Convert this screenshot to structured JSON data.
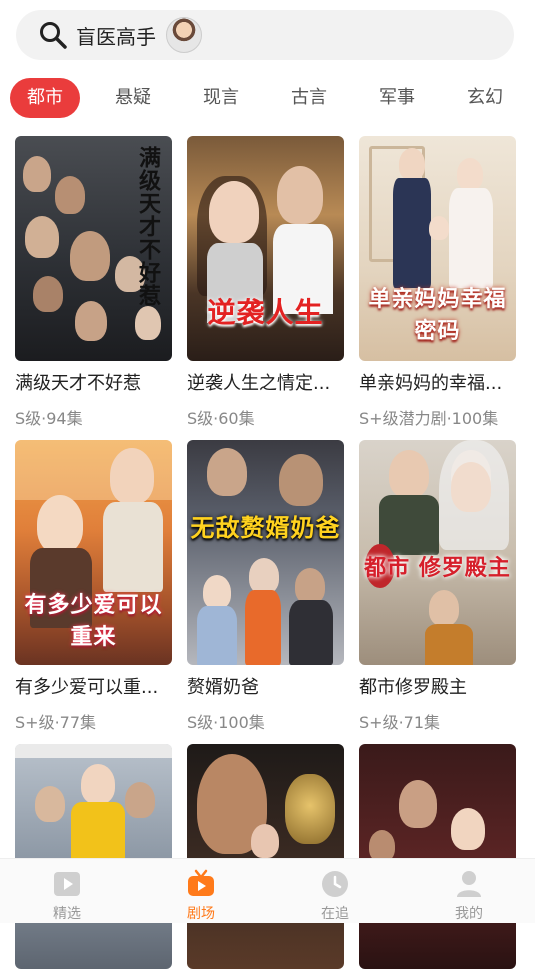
{
  "search": {
    "query": "盲医高手"
  },
  "tabs": [
    "都市",
    "悬疑",
    "现言",
    "古言",
    "军事",
    "玄幻"
  ],
  "cards": [
    {
      "title": "满级天才不好惹",
      "sub": "S级·94集",
      "poster_text": "满级天才不好惹"
    },
    {
      "title": "逆袭人生之情定...",
      "sub": "S级·60集",
      "poster_text": "逆袭人生"
    },
    {
      "title": "单亲妈妈的幸福...",
      "sub": "S+级潜力剧·100集",
      "poster_text": "单亲妈妈幸福密码"
    },
    {
      "title": "有多少爱可以重...",
      "sub": "S+级·77集",
      "poster_text": "有多少爱可以重来"
    },
    {
      "title": "赘婿奶爸",
      "sub": "S级·100集",
      "poster_text": "无敌赘婿奶爸"
    },
    {
      "title": "都市修罗殿主",
      "sub": "S+级·71集",
      "poster_text": "都市 修罗殿主"
    },
    {
      "title": "",
      "sub": "",
      "poster_text": ""
    },
    {
      "title": "",
      "sub": "",
      "poster_text": ""
    },
    {
      "title": "",
      "sub": "",
      "poster_text": ""
    }
  ],
  "nav": [
    {
      "label": "精选",
      "icon": "play-square-icon"
    },
    {
      "label": "剧场",
      "icon": "tv-icon"
    },
    {
      "label": "在追",
      "icon": "clock-icon"
    },
    {
      "label": "我的",
      "icon": "user-icon"
    }
  ],
  "colors": {
    "accent": "#ea3c3c",
    "nav_active": "#ff7a1a"
  }
}
